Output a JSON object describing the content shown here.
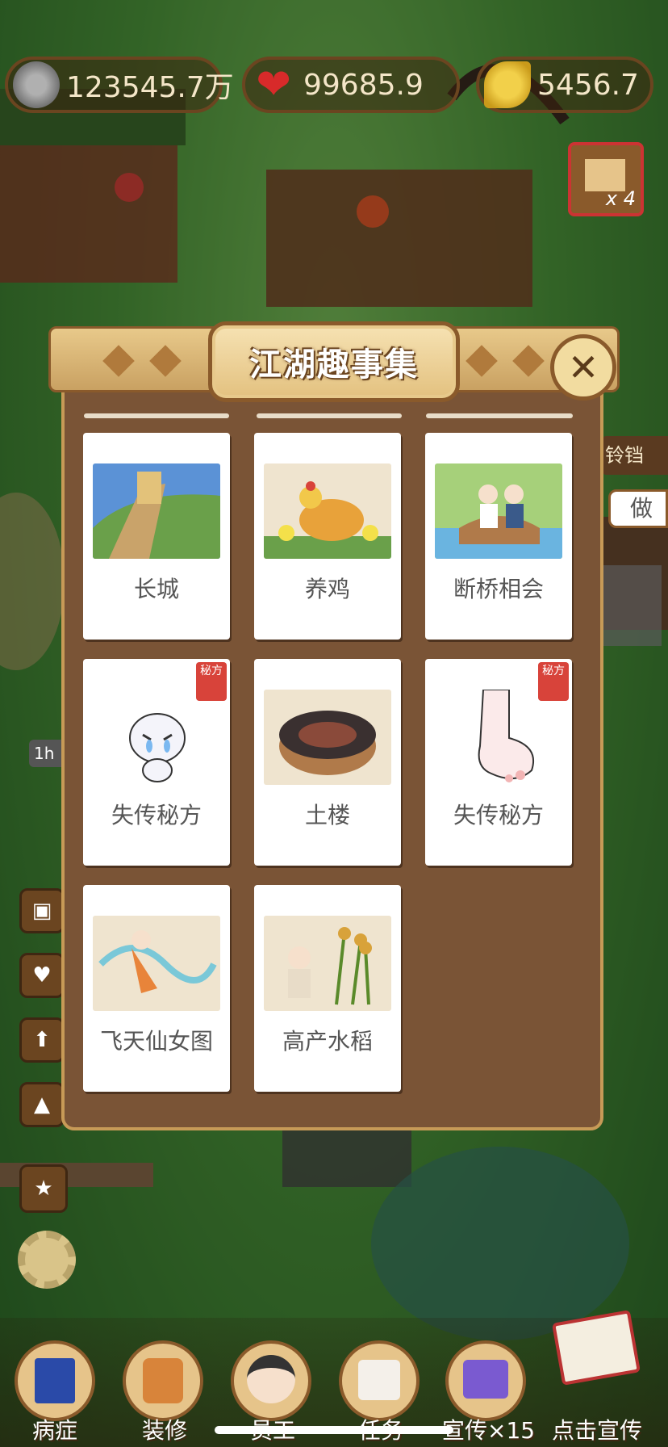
{
  "resources": {
    "coins": "123545.7万",
    "hearts": "99685.9",
    "leaves": "5456.7"
  },
  "item_box": {
    "count": "x 4"
  },
  "modal": {
    "title": "江湖趣事集",
    "close_symbol": "✕",
    "cards": [
      {
        "label": "长城",
        "icon": "great-wall-icon",
        "secret": false
      },
      {
        "label": "养鸡",
        "icon": "hen-chicks-icon",
        "secret": false
      },
      {
        "label": "断桥相会",
        "icon": "bridge-couple-icon",
        "secret": false
      },
      {
        "label": "失传秘方",
        "icon": "crying-creature-icon",
        "secret": true
      },
      {
        "label": "土楼",
        "icon": "tulou-icon",
        "secret": false
      },
      {
        "label": "失传秘方",
        "icon": "foot-icon",
        "secret": true
      },
      {
        "label": "飞天仙女图",
        "icon": "flying-fairy-icon",
        "secret": false
      },
      {
        "label": "高产水稻",
        "icon": "rice-elder-icon",
        "secret": false
      }
    ],
    "secret_stamp": "秘方"
  },
  "side": {
    "partial_label_right": "做",
    "partial_label_right2": "铃铛",
    "timer": "1h"
  },
  "bottom_bar": {
    "items": [
      "病症",
      "装修",
      "员工",
      "任务",
      "宣传×15",
      "点击宣传"
    ]
  },
  "colors": {
    "panel": "#7a5436",
    "frame": "#c79a57",
    "card": "#ffffff",
    "stamp": "#d8433a"
  }
}
